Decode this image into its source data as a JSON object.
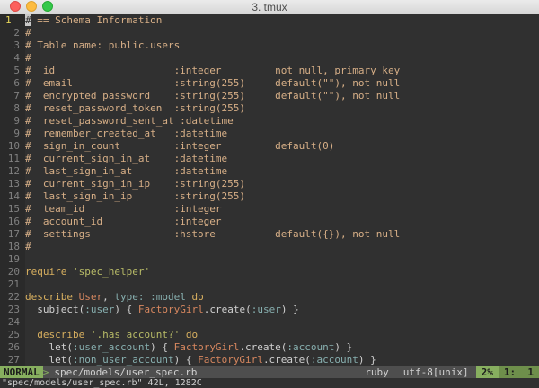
{
  "window": {
    "title": "3. tmux"
  },
  "lines": [
    {
      "n": "1",
      "current": true,
      "tokens": [
        {
          "t": "#",
          "c": "cursor"
        },
        {
          "t": " == Schema Information",
          "c": "comment"
        }
      ]
    },
    {
      "n": "2",
      "tokens": [
        {
          "t": "#",
          "c": "comment"
        }
      ]
    },
    {
      "n": "3",
      "tokens": [
        {
          "t": "# Table name: public.users",
          "c": "comment"
        }
      ]
    },
    {
      "n": "4",
      "tokens": [
        {
          "t": "#",
          "c": "comment"
        }
      ]
    },
    {
      "n": "5",
      "tokens": [
        {
          "t": "#  id                    :integer         not null, primary key",
          "c": "comment"
        }
      ]
    },
    {
      "n": "6",
      "tokens": [
        {
          "t": "#  email                 :string(255)     default(\"\"), not null",
          "c": "comment"
        }
      ]
    },
    {
      "n": "7",
      "tokens": [
        {
          "t": "#  encrypted_password    :string(255)     default(\"\"), not null",
          "c": "comment"
        }
      ]
    },
    {
      "n": "8",
      "tokens": [
        {
          "t": "#  reset_password_token  :string(255)",
          "c": "comment"
        }
      ]
    },
    {
      "n": "9",
      "tokens": [
        {
          "t": "#  reset_password_sent_at :datetime",
          "c": "comment"
        }
      ]
    },
    {
      "n": "9",
      "tokens": [
        {
          "t": "#  remember_created_at   :datetime",
          "c": "comment"
        }
      ]
    },
    {
      "n": "10",
      "tokens": [
        {
          "t": "#  sign_in_count         :integer         default(0)",
          "c": "comment"
        }
      ]
    },
    {
      "n": "11",
      "tokens": [
        {
          "t": "#  current_sign_in_at    :datetime",
          "c": "comment"
        }
      ]
    },
    {
      "n": "12",
      "tokens": [
        {
          "t": "#  last_sign_in_at       :datetime",
          "c": "comment"
        }
      ]
    },
    {
      "n": "13",
      "tokens": [
        {
          "t": "#  current_sign_in_ip    :string(255)",
          "c": "comment"
        }
      ]
    },
    {
      "n": "14",
      "tokens": [
        {
          "t": "#  last_sign_in_ip       :string(255)",
          "c": "comment"
        }
      ]
    },
    {
      "n": "15",
      "tokens": [
        {
          "t": "#  team_id               :integer",
          "c": "comment"
        }
      ]
    },
    {
      "n": "16",
      "tokens": [
        {
          "t": "#  account_id            :integer",
          "c": "comment"
        }
      ]
    },
    {
      "n": "17",
      "tokens": [
        {
          "t": "#  settings              :hstore          default({}), not null",
          "c": "comment"
        }
      ]
    },
    {
      "n": "18",
      "tokens": [
        {
          "t": "#",
          "c": "comment"
        }
      ]
    },
    {
      "n": "19",
      "tokens": []
    },
    {
      "n": "20",
      "tokens": [
        {
          "t": "require ",
          "c": "keyword"
        },
        {
          "t": "'spec_helper'",
          "c": "string"
        }
      ]
    },
    {
      "n": "21",
      "tokens": []
    },
    {
      "n": "22",
      "tokens": [
        {
          "t": "describe ",
          "c": "keyword"
        },
        {
          "t": "User",
          "c": "const"
        },
        {
          "t": ", ",
          "c": "plain"
        },
        {
          "t": "type:",
          "c": "symbol"
        },
        {
          "t": " ",
          "c": "plain"
        },
        {
          "t": ":model",
          "c": "symbol"
        },
        {
          "t": " do",
          "c": "keyword"
        }
      ]
    },
    {
      "n": "23",
      "tokens": [
        {
          "t": "  subject(",
          "c": "plain"
        },
        {
          "t": ":user",
          "c": "symbol"
        },
        {
          "t": ") { ",
          "c": "plain"
        },
        {
          "t": "FactoryGirl",
          "c": "const"
        },
        {
          "t": ".create(",
          "c": "plain"
        },
        {
          "t": ":user",
          "c": "symbol"
        },
        {
          "t": ") }",
          "c": "plain"
        }
      ]
    },
    {
      "n": "24",
      "tokens": []
    },
    {
      "n": "25",
      "tokens": [
        {
          "t": "  describe ",
          "c": "keyword"
        },
        {
          "t": "'.has_account?'",
          "c": "string"
        },
        {
          "t": " do",
          "c": "keyword"
        }
      ]
    },
    {
      "n": "26",
      "tokens": [
        {
          "t": "    let(",
          "c": "plain"
        },
        {
          "t": ":user_account",
          "c": "symbol"
        },
        {
          "t": ") { ",
          "c": "plain"
        },
        {
          "t": "FactoryGirl",
          "c": "const"
        },
        {
          "t": ".create(",
          "c": "plain"
        },
        {
          "t": ":account",
          "c": "symbol"
        },
        {
          "t": ") }",
          "c": "plain"
        }
      ]
    },
    {
      "n": "27",
      "tokens": [
        {
          "t": "    let(",
          "c": "plain"
        },
        {
          "t": ":non_user_account",
          "c": "symbol"
        },
        {
          "t": ") { ",
          "c": "plain"
        },
        {
          "t": "FactoryGirl",
          "c": "const"
        },
        {
          "t": ".create(",
          "c": "plain"
        },
        {
          "t": ":account",
          "c": "symbol"
        },
        {
          "t": ") }",
          "c": "plain"
        }
      ]
    }
  ],
  "statusline": {
    "mode": "NORMAL",
    "arrow": ">",
    "file": "spec/models/user_spec.rb",
    "filetype": "ruby",
    "encoding": "utf-8[unix]",
    "percent": "2%",
    "position": "1:  1"
  },
  "cmdline": {
    "text": "\"spec/models/user_spec.rb\" 42L, 1282C"
  },
  "colors": {
    "background": "#303030",
    "comment": "#d7af87",
    "mode_bg": "#87af5f"
  }
}
